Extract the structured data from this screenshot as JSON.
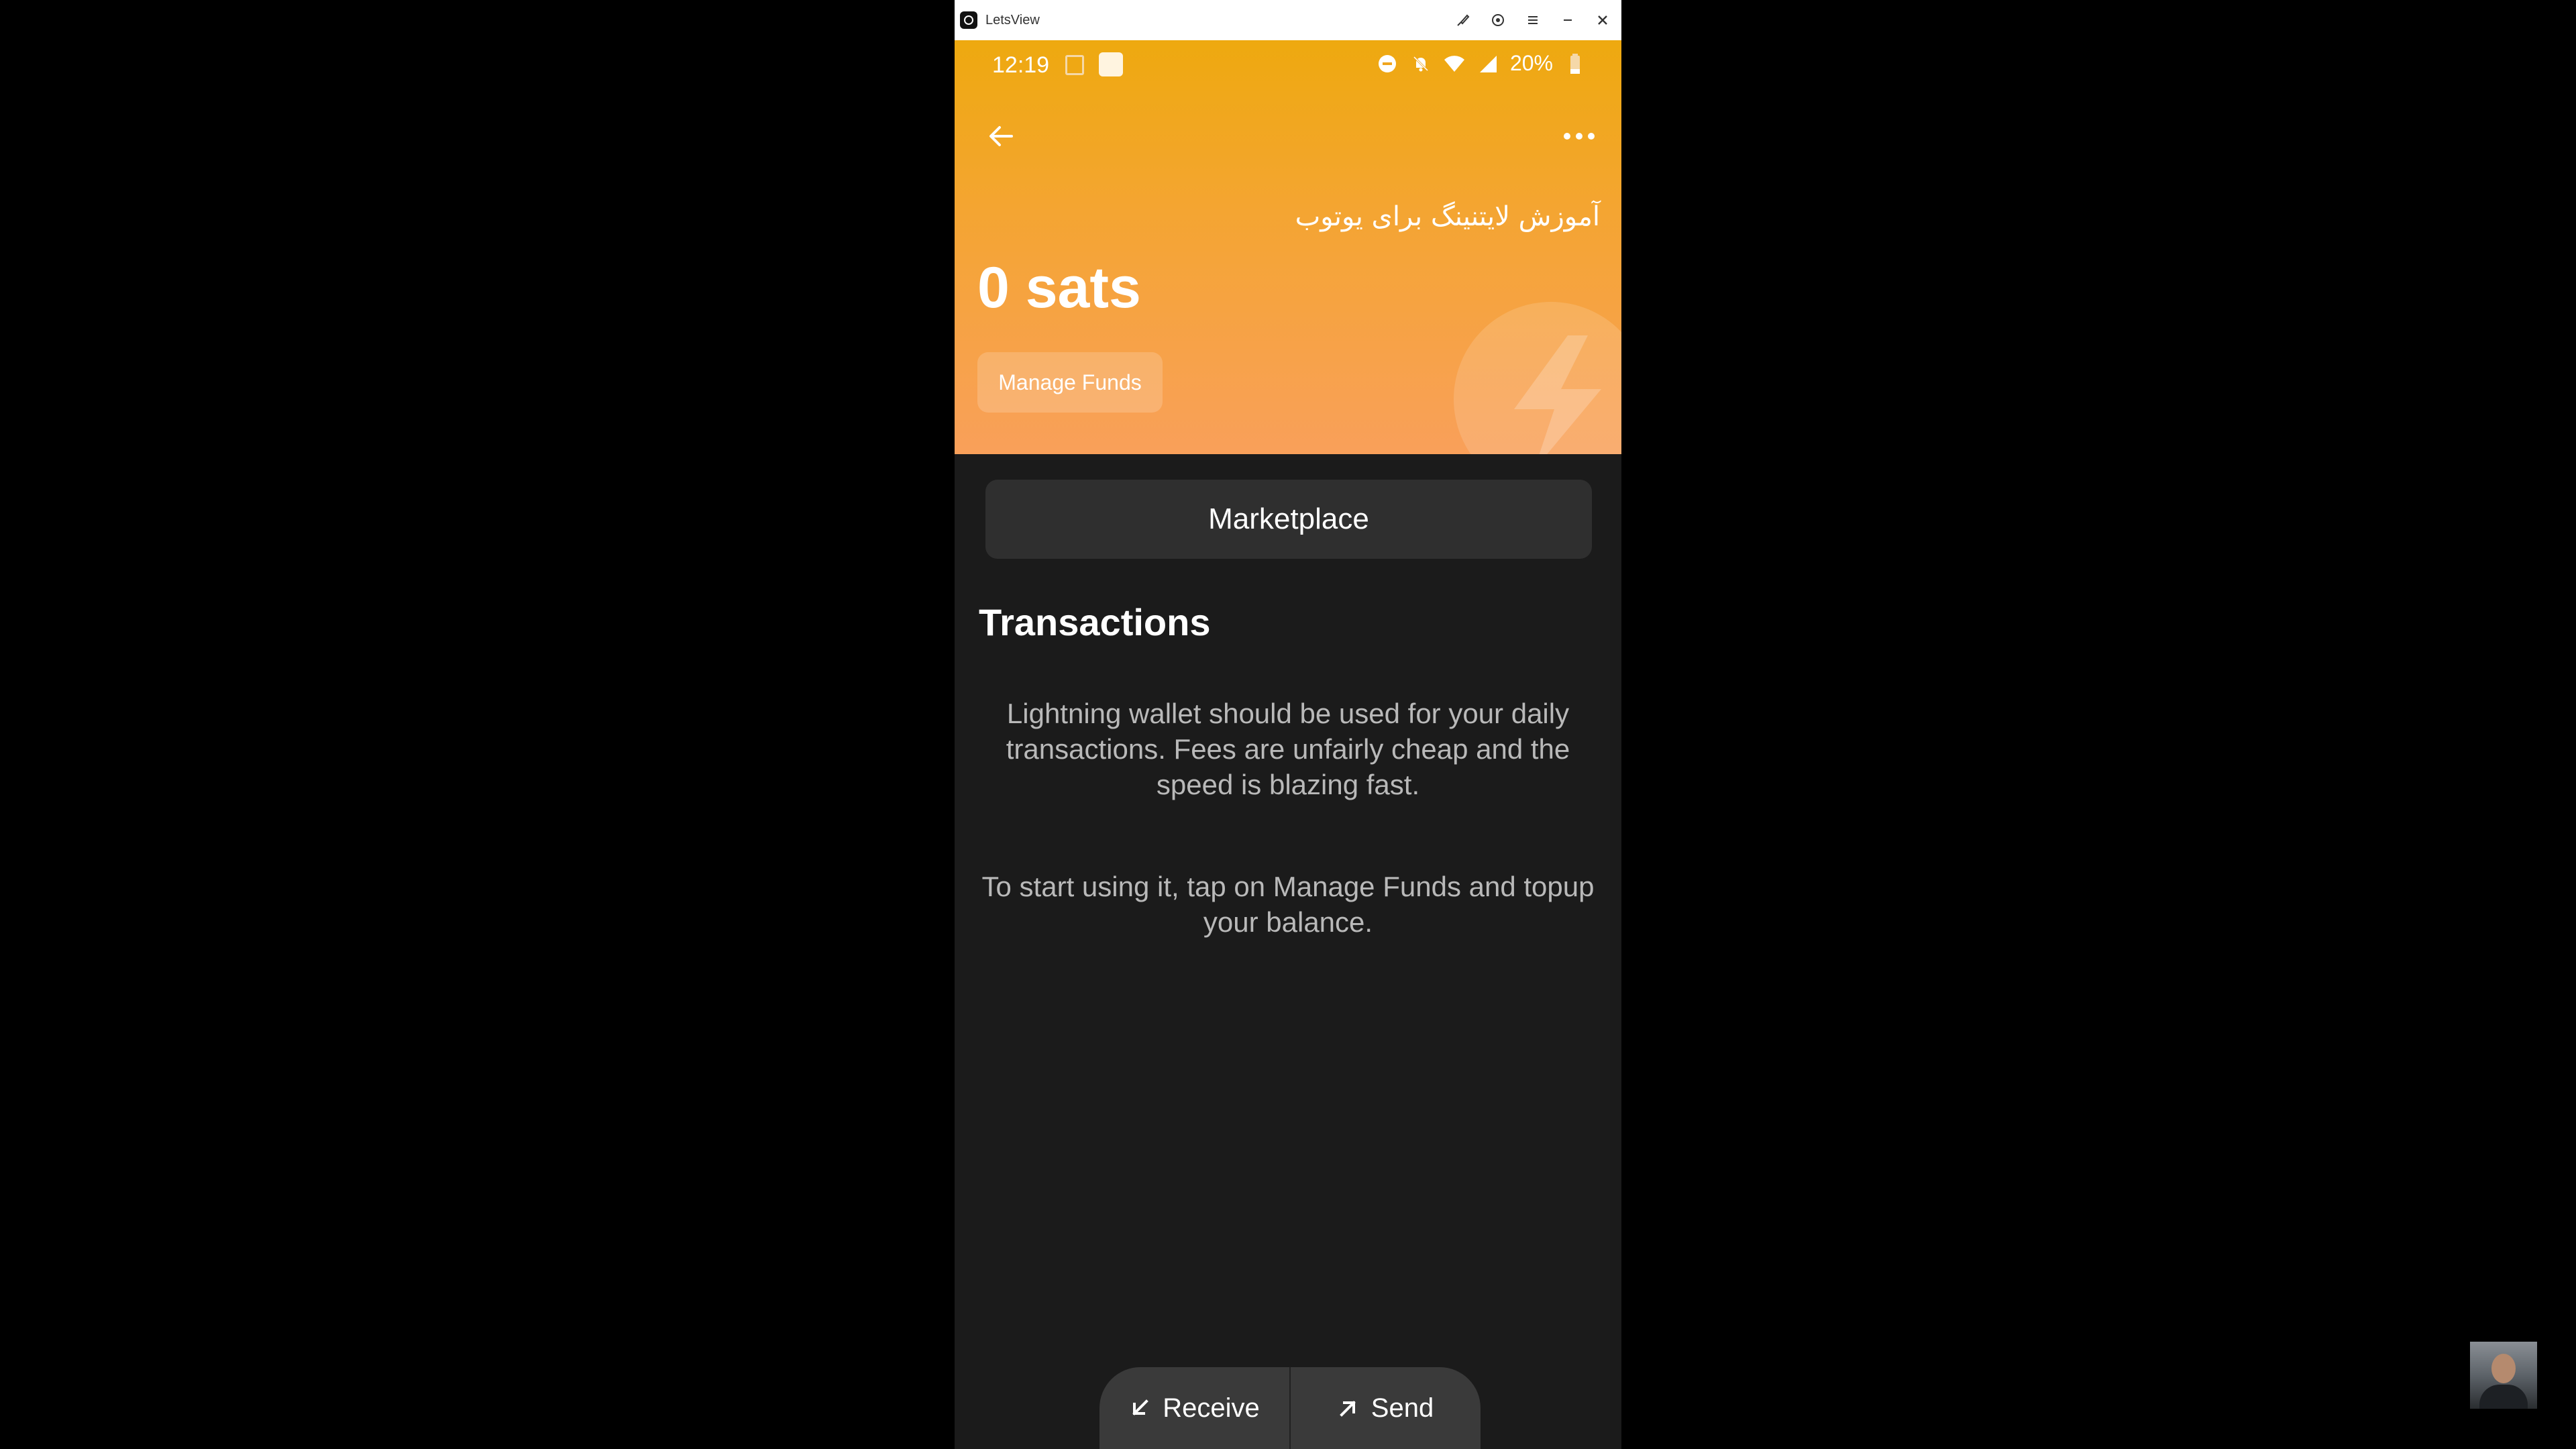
{
  "window": {
    "title": "LetsView"
  },
  "status_bar": {
    "time": "12:19",
    "battery": "20%"
  },
  "wallet": {
    "name": "آموزش لایتنینگ برای یوتوب",
    "balance": "0 sats",
    "manage_funds_label": "Manage Funds"
  },
  "body": {
    "marketplace_label": "Marketplace",
    "transactions_title": "Transactions",
    "empty_text_1": "Lightning wallet should be used for your daily transactions. Fees are unfairly cheap and the speed is blazing fast.",
    "empty_text_2": "To start using it, tap on Manage Funds and topup your balance."
  },
  "actions": {
    "receive_label": "Receive",
    "send_label": "Send"
  },
  "colors": {
    "header_top": "#eea90f",
    "header_bottom": "#f9a05a",
    "body_bg": "#1b1b1b",
    "button_bg": "#2f2f2f"
  },
  "icons": {
    "back": "arrow-left-icon",
    "more": "more-horizontal-icon",
    "receive": "arrow-down-left-icon",
    "send": "arrow-up-right-icon"
  }
}
